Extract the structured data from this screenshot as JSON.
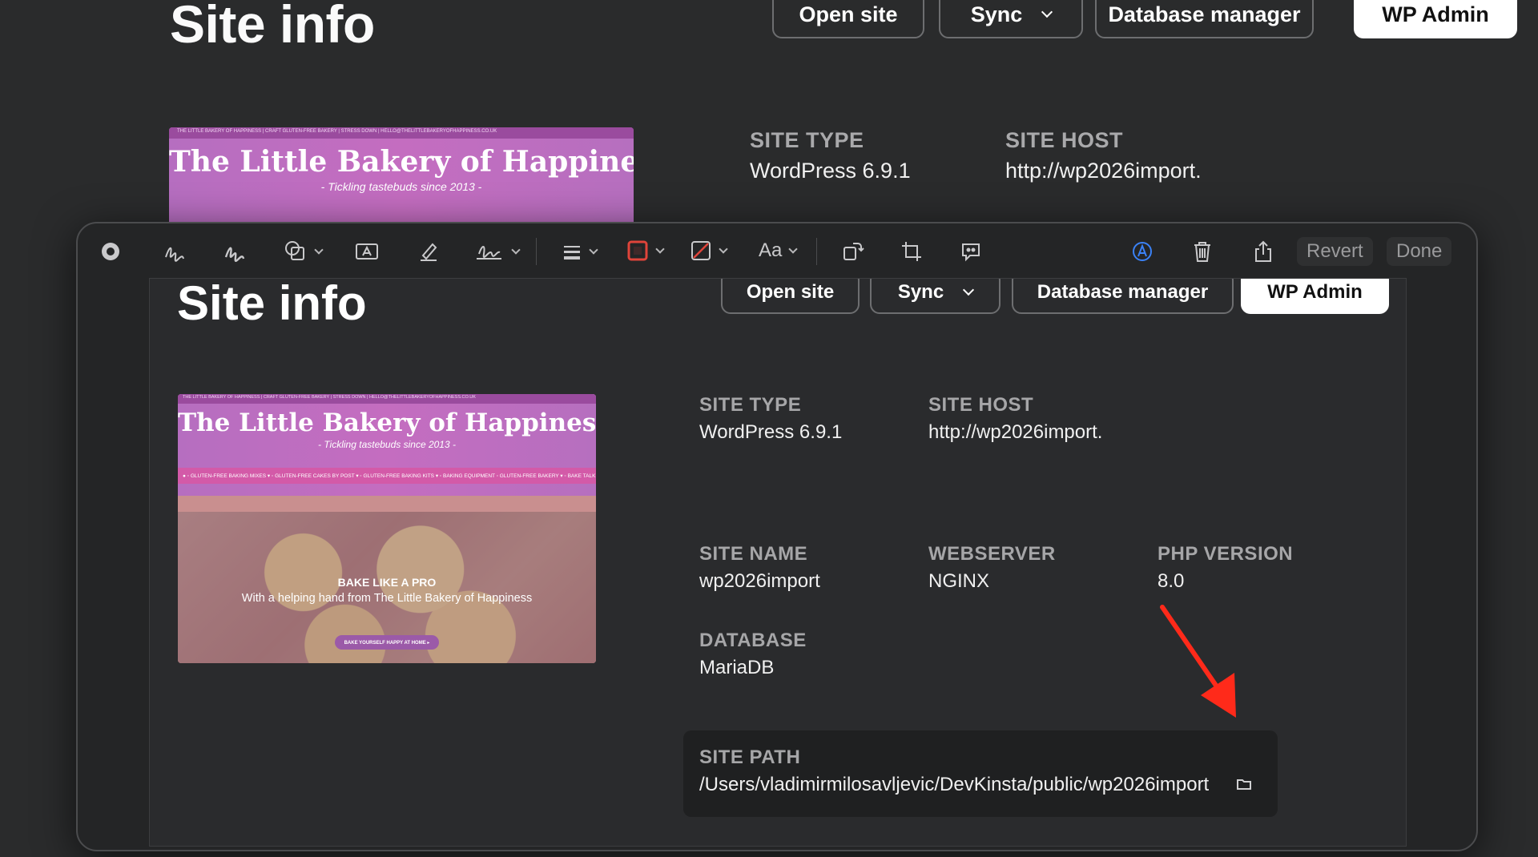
{
  "background": {
    "title": "Site info",
    "buttons": {
      "open_site": "Open site",
      "sync": "Sync",
      "database_manager": "Database manager",
      "wp_admin": "WP Admin"
    },
    "site_type": {
      "label": "SITE TYPE",
      "value": "WordPress 6.9.1"
    },
    "site_host": {
      "label": "SITE HOST",
      "value": "http://wp2026import."
    },
    "thumbnail": {
      "top_bar": "THE LITTLE BAKERY OF HAPPINESS | CRAFT GLUTEN-FREE BAKERY | STRESS DOWN | HELLO@THELITTLEBAKERYOFHAPPINESS.CO.UK",
      "title": "The Little Bakery of Happiness",
      "subtitle": "- Tickling tastebuds since 2013 -"
    }
  },
  "toolbar": {
    "icons": [
      "record-icon",
      "sketch-icon",
      "draw-icon",
      "shapes-icon",
      "text-box-icon",
      "highlight-icon",
      "signature-icon",
      "line-style-icon",
      "border-color-icon",
      "fill-color-icon",
      "text-style-icon",
      "rotate-icon",
      "crop-icon",
      "speech-bubble-icon",
      "annotate-icon",
      "trash-icon",
      "share-icon"
    ],
    "text_style": "Aa",
    "revert": "Revert",
    "done": "Done",
    "colors": {
      "border": "#e0443a",
      "fill_slash": "#e0443a",
      "annotate_accent": "#3b82f6"
    }
  },
  "canvas": {
    "title": "Site info",
    "buttons": {
      "open_site": "Open site",
      "sync": "Sync",
      "database_manager": "Database manager",
      "wp_admin": "WP Admin"
    },
    "thumbnail": {
      "top_bar": "THE LITTLE BAKERY OF HAPPINESS | CRAFT GLUTEN-FREE BAKERY | STRESS DOWN | HELLO@THELITTLEBAKERYOFHAPPINESS.CO.UK",
      "title": "The Little Bakery of Happiness",
      "subtitle": "- Tickling tastebuds since 2013 -",
      "nav": "● ◦ GLUTEN-FREE BAKING MIXES ▾ ◦ GLUTEN-FREE CAKES BY POST ▾ ◦ GLUTEN-FREE BAKING KITS ▾ ◦ BAKING EQUIPMENT ◦ GLUTEN-FREE BAKERY ▾ ◦ BAKE TALK ▾",
      "hero_heading": "BAKE LIKE A PRO",
      "hero_text": "With a helping hand from The Little Bakery of Happiness",
      "hero_button": "BAKE YOURSELF HAPPY AT HOME ▸"
    },
    "site_type": {
      "label": "SITE TYPE",
      "value": "WordPress 6.9.1"
    },
    "site_host": {
      "label": "SITE HOST",
      "value": "http://wp2026import."
    },
    "site_name": {
      "label": "SITE NAME",
      "value": "wp2026import"
    },
    "webserver": {
      "label": "WEBSERVER",
      "value": "NGINX"
    },
    "php_version": {
      "label": "PHP VERSION",
      "value": "8.0"
    },
    "database": {
      "label": "DATABASE",
      "value": "MariaDB"
    },
    "site_path": {
      "label": "SITE PATH",
      "value": "/Users/vladimirmilosavljevic/DevKinsta/public/wp2026import"
    },
    "annotation_arrow_color": "#ff2a1a"
  }
}
